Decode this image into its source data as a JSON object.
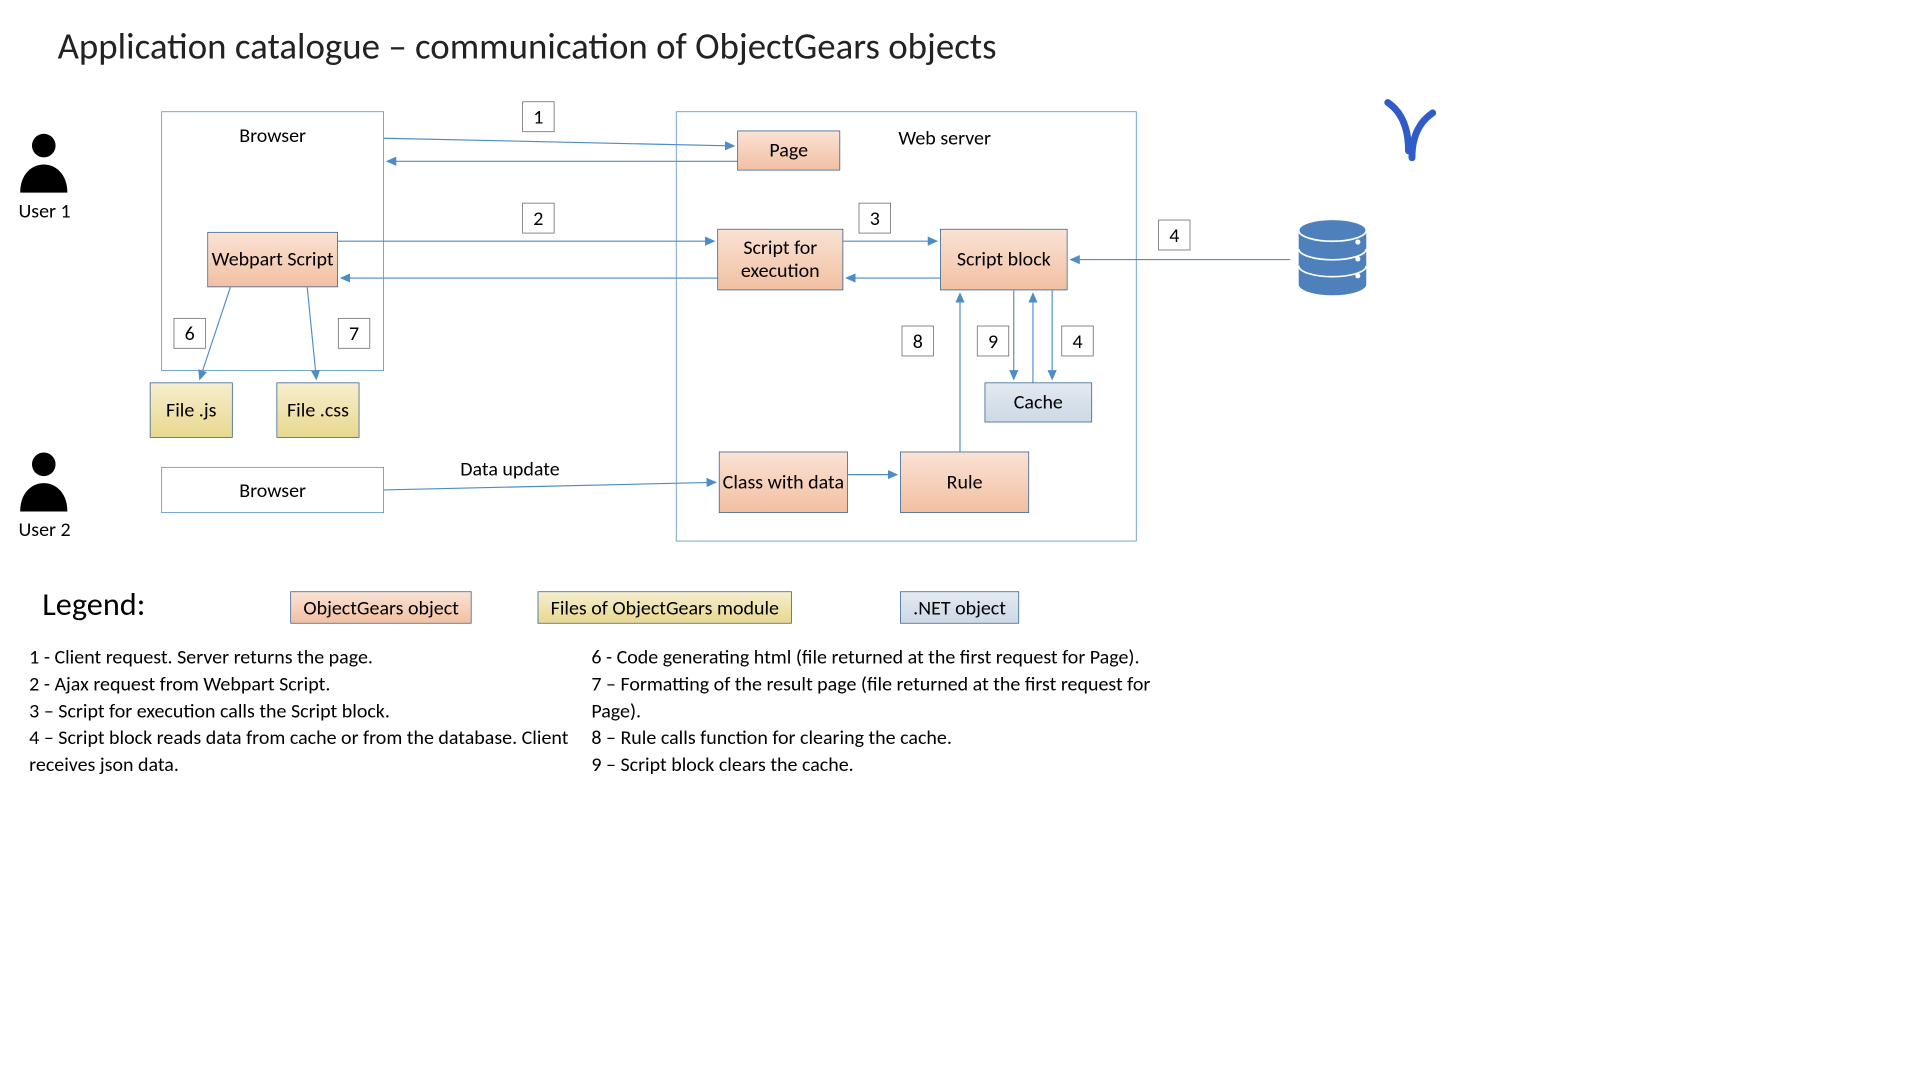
{
  "title": "Application catalogue – communication of ObjectGears objects",
  "users": {
    "u1": "User 1",
    "u2": "User 2"
  },
  "containers": {
    "browser1": "Browser",
    "browser2": "Browser",
    "webserver": "Web server"
  },
  "boxes": {
    "webpart": "Webpart Script",
    "page": "Page",
    "script_exec": "Script for execution",
    "script_block": "Script block",
    "cache": "Cache",
    "class_data": "Class with data",
    "rule": "Rule",
    "file_js": "File .js",
    "file_css": "File .css"
  },
  "edge_label": "Data update",
  "nums": {
    "n1": "1",
    "n2": "2",
    "n3": "3",
    "n4": "4",
    "n4b": "4",
    "n6": "6",
    "n7": "7",
    "n8": "8",
    "n9": "9"
  },
  "legend": {
    "title": "Legend:",
    "swatch_og": "ObjectGears object",
    "swatch_file": "Files of ObjectGears module",
    "swatch_net": ".NET object",
    "col1": [
      "1 -  Client request. Server returns the page.",
      "2 - Ajax request from Webpart Script.",
      "3 – Script for execution calls the Script block.",
      "4 – Script block reads data from cache or from the database. Client receives json data."
    ],
    "col2": [
      "6 - Code generating html (file returned at the first request for Page).",
      "7 – Formatting of the result page (file returned at the first request for Page).",
      "8 – Rule calls function for clearing the cache.",
      "9 – Script block clears the cache."
    ]
  }
}
